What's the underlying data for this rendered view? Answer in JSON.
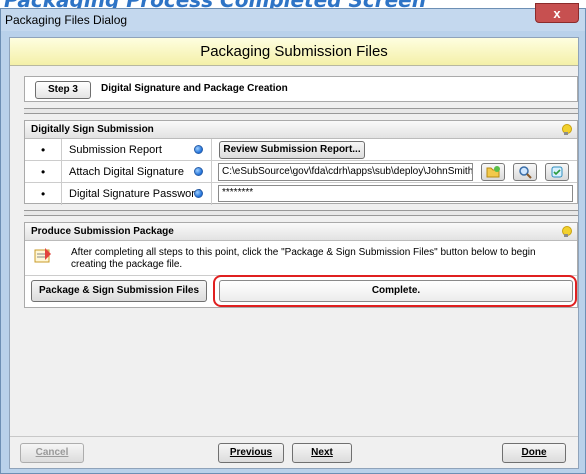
{
  "banner": {
    "text": "Packaging Process Completed Screen"
  },
  "window": {
    "title": "Packaging Files Dialog",
    "close_label": "x"
  },
  "header": {
    "title": "Packaging Submission Files"
  },
  "step": {
    "label": "Step 3",
    "title": "Digital Signature and Package Creation"
  },
  "sign": {
    "heading": "Digitally Sign Submission",
    "rows": [
      {
        "label": "Submission Report",
        "button": "Review Submission Report..."
      },
      {
        "label": "Attach Digital Signature",
        "path": "C:\\eSubSource\\gov\\fda\\cdrh\\apps\\sub\\deploy\\JohnSmith"
      },
      {
        "label": "Digital Signature Password",
        "password": "********"
      }
    ],
    "icons": [
      "folder-icon",
      "magnifier-icon",
      "cert-icon"
    ]
  },
  "produce": {
    "heading": "Produce Submission Package",
    "info": "After completing all steps to this point, click the \"Package & Sign Submission Files\" button below to begin creating the package file.",
    "button": "Package & Sign Submission Files",
    "status": "Complete."
  },
  "footer": {
    "cancel": "Cancel",
    "previous": "Previous",
    "next": "Next",
    "done": "Done"
  },
  "colors": {
    "accent": "#2e74c6",
    "highlight_ring": "#e02020",
    "header_bg": "#f4f0a8"
  }
}
